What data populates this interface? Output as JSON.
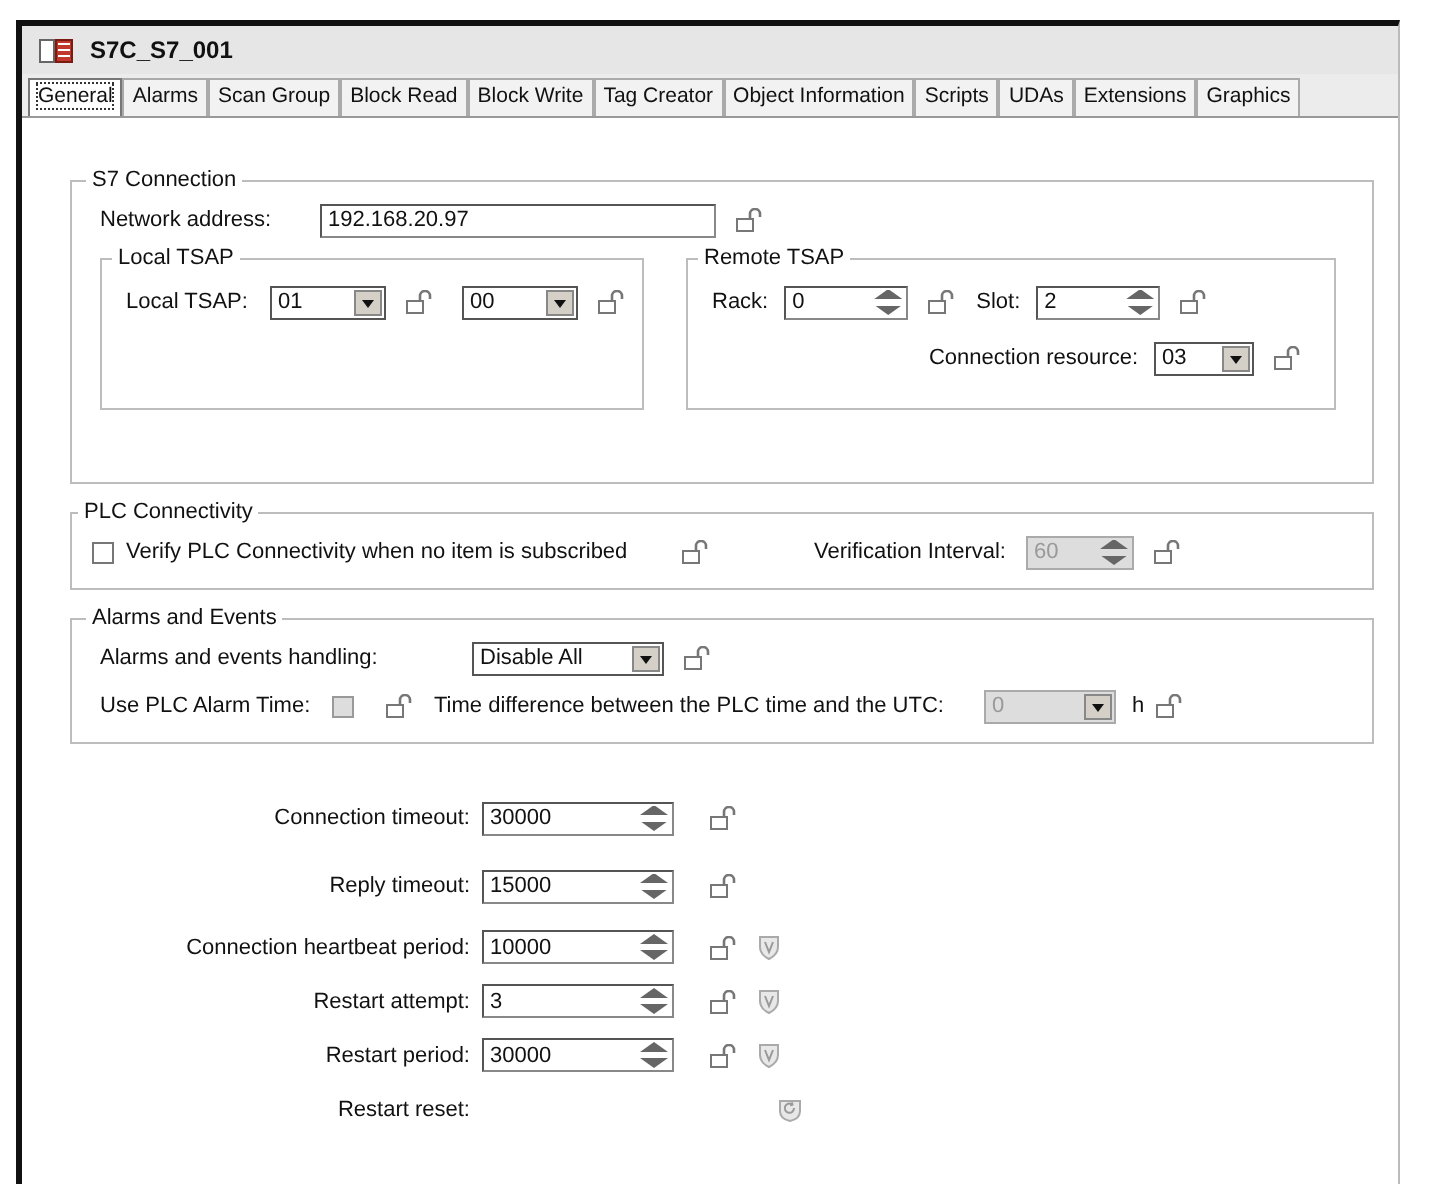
{
  "window": {
    "title": "S7C_S7_001"
  },
  "tabs": [
    {
      "label": "General",
      "selected": true
    },
    {
      "label": "Alarms",
      "selected": false
    },
    {
      "label": "Scan Group",
      "selected": false
    },
    {
      "label": "Block Read",
      "selected": false
    },
    {
      "label": "Block Write",
      "selected": false
    },
    {
      "label": "Tag Creator",
      "selected": false
    },
    {
      "label": "Object Information",
      "selected": false
    },
    {
      "label": "Scripts",
      "selected": false
    },
    {
      "label": "UDAs",
      "selected": false
    },
    {
      "label": "Extensions",
      "selected": false
    },
    {
      "label": "Graphics",
      "selected": false
    }
  ],
  "s7_connection": {
    "title": "S7 Connection",
    "network_address": {
      "label": "Network address:",
      "value": "192.168.20.97"
    },
    "local_tsap": {
      "title": "Local TSAP",
      "label": "Local TSAP:",
      "values": [
        "01",
        "00"
      ]
    },
    "remote_tsap": {
      "title": "Remote TSAP",
      "rack": {
        "label": "Rack:",
        "value": "0"
      },
      "slot": {
        "label": "Slot:",
        "value": "2"
      },
      "connection_resource": {
        "label": "Connection resource:",
        "value": "03"
      }
    }
  },
  "plc_connectivity": {
    "title": "PLC Connectivity",
    "verify": {
      "label": "Verify PLC Connectivity when no item is subscribed",
      "checked": false
    },
    "verification_interval": {
      "label": "Verification Interval:",
      "value": "60",
      "disabled": true
    }
  },
  "alarms_events": {
    "title": "Alarms and Events",
    "handling": {
      "label": "Alarms and events handling:",
      "value": "Disable All"
    },
    "use_plc_alarm_time": {
      "label": "Use PLC Alarm Time:",
      "checked": false,
      "disabled": true
    },
    "time_difference": {
      "label": "Time difference between the PLC time and the UTC:",
      "value": "0",
      "unit": "h",
      "disabled": true
    }
  },
  "settings": [
    {
      "kind": "spin",
      "label": "Connection timeout:",
      "value": "30000",
      "shield": false
    },
    {
      "kind": "spin",
      "label": "Reply timeout:",
      "value": "15000",
      "shield": false
    },
    {
      "kind": "spin",
      "label": "Connection heartbeat period:",
      "value": "10000",
      "shield": true
    },
    {
      "kind": "spin",
      "label": "Restart attempt:",
      "value": "3",
      "shield": true
    },
    {
      "kind": "spin",
      "label": "Restart period:",
      "value": "30000",
      "shield": true
    },
    {
      "kind": "reset",
      "label": "Restart reset:"
    }
  ]
}
